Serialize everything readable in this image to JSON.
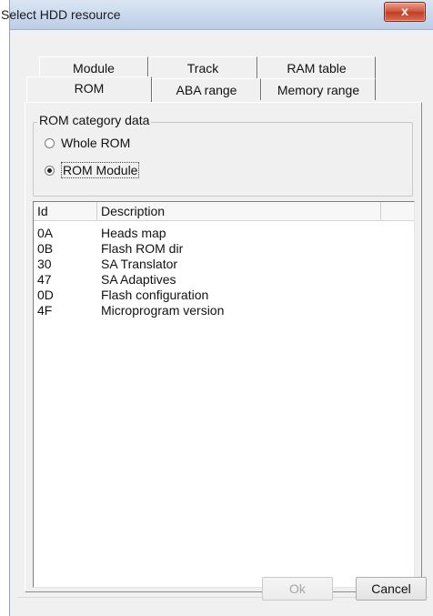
{
  "window": {
    "title": "Select HDD resource",
    "close_glyph": "x"
  },
  "tabs": {
    "row_back": [
      {
        "label": "Module"
      },
      {
        "label": "Track"
      },
      {
        "label": "RAM table"
      }
    ],
    "row_front": [
      {
        "label": "ROM",
        "active": true
      },
      {
        "label": "ABA range"
      },
      {
        "label": "Memory range"
      }
    ]
  },
  "rom_category": {
    "legend": "ROM category data",
    "options": [
      {
        "label": "Whole ROM",
        "checked": false
      },
      {
        "label": "ROM Module",
        "checked": true
      }
    ]
  },
  "list": {
    "columns": [
      "Id",
      "Description",
      ""
    ],
    "rows": [
      {
        "id": "0A",
        "description": "Heads map"
      },
      {
        "id": "0B",
        "description": "Flash ROM dir"
      },
      {
        "id": "30",
        "description": "SA Translator"
      },
      {
        "id": "47",
        "description": "SA Adaptives"
      },
      {
        "id": "0D",
        "description": "Flash configuration"
      },
      {
        "id": "4F",
        "description": "Microprogram version"
      }
    ]
  },
  "buttons": {
    "ok": "Ok",
    "cancel": "Cancel"
  },
  "colors": {
    "titlebar": "#c9d8ec",
    "close_button": "#c13d23",
    "dialog_bg": "#f0f0f0"
  }
}
